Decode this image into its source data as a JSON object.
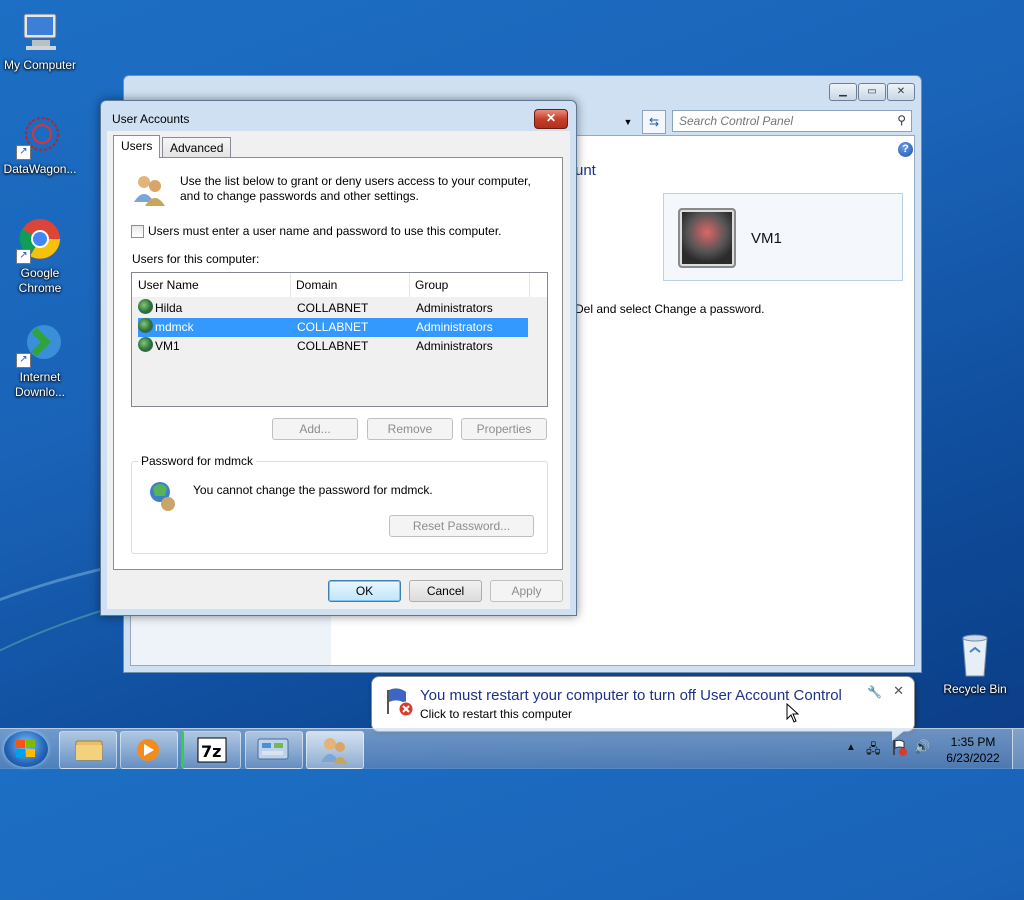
{
  "desktop": {
    "icons": [
      {
        "label": "My Computer"
      },
      {
        "label": "DataWagon..."
      },
      {
        "label": "Google Chrome"
      },
      {
        "label": "Internet Downlo..."
      },
      {
        "label": "Recycle Bin"
      }
    ]
  },
  "control_panel": {
    "search_placeholder": "Search Control Panel",
    "heading_fragment": "unt",
    "account_card_name": "VM1",
    "text_fragment": "Del and select Change a password.",
    "help_glyph": "?"
  },
  "dialog": {
    "title": "User Accounts",
    "tabs": [
      "Users",
      "Advanced"
    ],
    "intro": "Use the list below to grant or deny users access to your computer, and to change passwords and other settings.",
    "checkbox_label": "Users must enter a user name and password to use this computer.",
    "users_label": "Users for this computer:",
    "columns": [
      "User Name",
      "Domain",
      "Group"
    ],
    "rows": [
      {
        "name": "Hilda",
        "domain": "COLLABNET",
        "group": "Administrators"
      },
      {
        "name": "mdmck",
        "domain": "COLLABNET",
        "group": "Administrators"
      },
      {
        "name": "VM1",
        "domain": "COLLABNET",
        "group": "Administrators"
      }
    ],
    "buttons": {
      "add": "Add...",
      "remove": "Remove",
      "properties": "Properties"
    },
    "password_group": {
      "legend": "Password for mdmck",
      "message": "You cannot change the password for mdmck.",
      "reset": "Reset Password..."
    },
    "footer": {
      "ok": "OK",
      "cancel": "Cancel",
      "apply": "Apply"
    }
  },
  "notification": {
    "title": "You must restart your computer to turn off User Account Control",
    "subtitle": "Click to restart this computer"
  },
  "taskbar": {
    "time": "1:35 PM",
    "date": "6/23/2022"
  }
}
